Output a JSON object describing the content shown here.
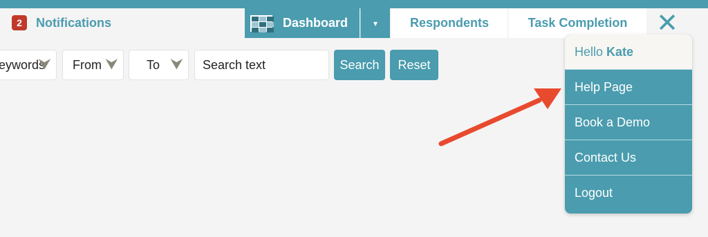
{
  "colors": {
    "accent": "#4a9cae",
    "badge": "#c0392b",
    "arrow": "#e84a2e",
    "background": "#f4f4f4"
  },
  "header": {
    "notifications": {
      "count": "2",
      "label": "Notifications",
      "icon": "badge"
    },
    "dashboard": {
      "label": "Dashboard",
      "icon": "dashboard-grid-icon",
      "caret": "▾"
    },
    "tabs": [
      {
        "label": "Respondents"
      },
      {
        "label": "Task Completion"
      }
    ],
    "close_glyph": "✕"
  },
  "filters": {
    "keywords_label": "Keywords",
    "from_label": "From",
    "to_label": "To",
    "dropdown_glyph": "⮟",
    "search_placeholder": "Search text",
    "search_button": "Search",
    "reset_button": "Reset"
  },
  "user_menu": {
    "greeting": "Hello",
    "username": "Kate",
    "items": [
      {
        "label": "Help Page"
      },
      {
        "label": "Book a Demo"
      },
      {
        "label": "Contact Us"
      },
      {
        "label": "Logout"
      }
    ]
  },
  "annotation": {
    "type": "arrow",
    "points_to": "Help Page"
  }
}
